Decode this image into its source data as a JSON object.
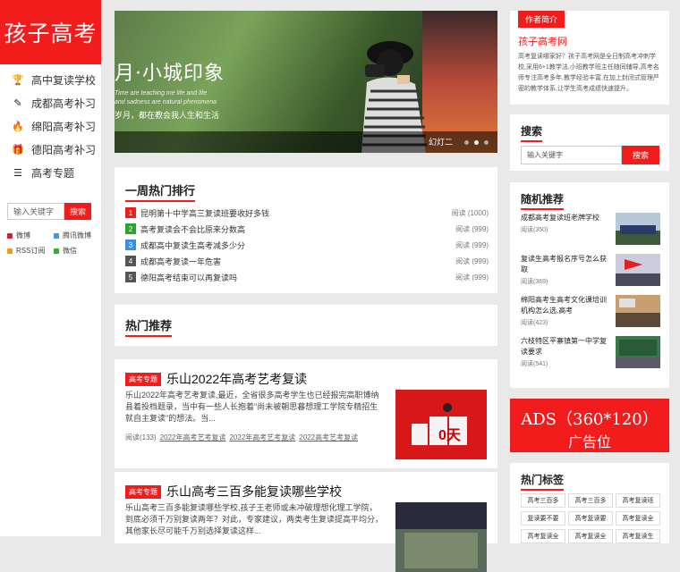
{
  "site": {
    "logo": "孩子高考"
  },
  "nav": [
    {
      "icon": "trophy-icon",
      "glyph": "🏆",
      "label": "高中复读学校"
    },
    {
      "icon": "pencil-icon",
      "glyph": "✎",
      "label": "成都高考补习"
    },
    {
      "icon": "fire-icon",
      "glyph": "🔥",
      "label": "绵阳高考补习"
    },
    {
      "icon": "gift-icon",
      "glyph": "🎁",
      "label": "德阳高考补习"
    },
    {
      "icon": "list-icon",
      "glyph": "☰",
      "label": "高考专题"
    }
  ],
  "side_search": {
    "placeholder": "输入关键字",
    "button": "搜索"
  },
  "social": [
    {
      "label": "微博",
      "color": "#e6162d"
    },
    {
      "label": "腾讯微博",
      "color": "#3b9ae8"
    },
    {
      "label": "RSS订阅",
      "color": "#f59a16"
    },
    {
      "label": "微信",
      "color": "#2db32d"
    }
  ],
  "slider": {
    "title": "月·小城印象",
    "line1": "Time are teaching me life and life",
    "line2": "and sadness are natural phenomena",
    "line3": "岁月，都在教会我人生和生活",
    "caption": "幻灯二",
    "active_dot": 2
  },
  "hot_week": {
    "title": "一周热门排行",
    "items": [
      {
        "n": "1",
        "color": "#f21c1c",
        "title": "昆明第十中学高三复读班要收好多钱",
        "reads": "阅读 (1000)"
      },
      {
        "n": "2",
        "color": "#2aa42a",
        "title": "高考复读会不会比原来分数高",
        "reads": "阅读 (999)"
      },
      {
        "n": "3",
        "color": "#3b8fe0",
        "title": "成都高中复读生高考减多少分",
        "reads": "阅读 (999)"
      },
      {
        "n": "4",
        "color": "#555555",
        "title": "成都高考复读一年危害",
        "reads": "阅读 (999)"
      },
      {
        "n": "5",
        "color": "#555555",
        "title": "德阳高考结束可以再复读吗",
        "reads": "阅读 (999)"
      }
    ]
  },
  "recommend": {
    "title": "热门推荐"
  },
  "articles": [
    {
      "tag": "高考专题",
      "title": "乐山2022年高考艺考复读",
      "desc": "乐山2022年高考艺考复读,最近，全省很多高考学生也已经报完高职博纳县着投档题录，当中有一些人长抱着\"尚未被朝思暮想理工学院专精招生就自主复读\"的想法。当...",
      "reads": "阅读(133)",
      "tags": [
        "2022年高考艺考复读",
        "2022年高考艺考复读",
        "2022高考艺考复读"
      ],
      "thumb_text": "0天"
    },
    {
      "tag": "高考专题",
      "title": "乐山高考三百多能复读哪些学校",
      "desc": "乐山高考三百多能复读哪些学校,孩子王老师或未冲破理想化理工学院，到底必须千万别复读两年？对此，专家建议，两类考生复读提高平均分，其他家长尽可能千万别选择复读这样...",
      "reads": "",
      "tags": [],
      "thumb_text": ""
    }
  ],
  "author": {
    "label": "作者简介",
    "name": "孩子高考网",
    "intro": "高考复读哪家好？孩子高考网是全日制高考冲刺学校,采用6+1教学法,小班教学班主任随同辅导,高考名师专注高考多年,教学经验丰富,在加上封闭式管理严密的教学体系,让学生高考成绩快速提升。"
  },
  "search": {
    "title": "搜索",
    "placeholder": "输入关键字",
    "button": "搜索"
  },
  "random": {
    "title": "随机推荐",
    "items": [
      {
        "title": "成都高考复读班老牌学校",
        "reads": "阅读(350)"
      },
      {
        "title": "复读生高考报名序号怎么获取",
        "reads": "阅读(369)"
      },
      {
        "title": "绵阳高考生高考文化课培训机构怎么选,高考",
        "reads": "阅读(423)"
      },
      {
        "title": "六枝特区平寨镇第一中学复读要求",
        "reads": "阅读(541)"
      }
    ]
  },
  "ads": {
    "line1": "ADS（360*120）",
    "line2": "广告位"
  },
  "hot_tags": {
    "title": "热门标签",
    "items": [
      "高考三百多",
      "高考三百多",
      "高考复读班",
      "复读要不要",
      "高考复读要",
      "高考复读全",
      "高考复读全",
      "高考复读全",
      "高考复读生"
    ]
  }
}
